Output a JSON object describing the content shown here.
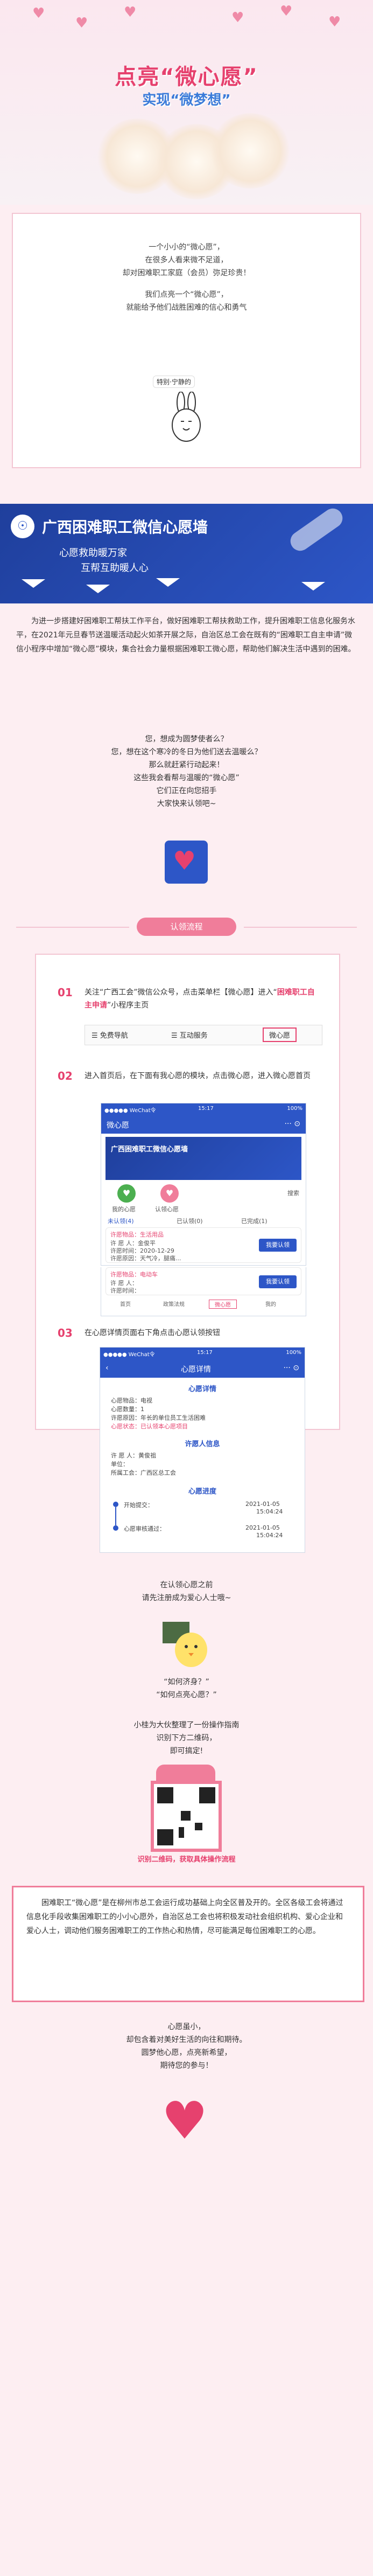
{
  "header": {
    "title": "点亮“微心愿”",
    "subtitle": "实现“微梦想”"
  },
  "intro_poem": [
    "一个小小的“微心愿”，",
    "在很多人看来微不足道，",
    "却对困难职工家庭（会员）弥足珍贵！",
    "我们点亮一个“微心愿”，",
    "就能给予他们战胜困难的信心和勇气"
  ],
  "bunny_caption": "特别·宁静的",
  "banner": {
    "title": "广西困难职工微信心愿墙",
    "slogan_line1": "心愿救助暖万家",
    "slogan_line2": "互帮互助暖人心"
  },
  "intro_paragraph": "为进一步搭建好困难职工帮扶工作平台，做好困难职工帮扶救助工作，提升困难职工信息化服务水平，在2021年元旦春节送温暖活动起火如茶开展之际，自治区总工会在既有的“困难职工自主申请”微信小程序中增加“微心愿”模块，集合社会力量根据困难职工微心愿，帮助他们解决生活中遇到的困难。",
  "questions": [
    "您，想成为圆梦使者么？",
    "您，想在这个寒冷的冬日为他们送去温暖么？",
    "那么就赶紧行动起来！",
    "这些我会看帮与温暖的“微心愿”",
    "它们正在向您招手",
    "大家快来认领吧~"
  ],
  "section_tag": "认领流程",
  "steps": [
    {
      "num": "01",
      "text_part1": "关注“广西工会”微信公众号，点击菜单栏【微心愿】进入“",
      "text_highlight": "困难职工自主申请",
      "text_part2": "”小程序主页"
    },
    {
      "num": "02",
      "text": "进入首页后，在下面有我心愿的模块，点击微心愿，进入微心愿首页"
    },
    {
      "num": "03",
      "text": "在心愿详情页面右下角点击心愿认领按钮"
    }
  ],
  "step1_menu": {
    "item1": "☰ 免费导航",
    "item2": "☰ 互动服务",
    "item3": "微心愿"
  },
  "phone1": {
    "status_left": "●●●●● WeChat令",
    "time": "15:17",
    "battery": "100%",
    "title": "微心愿",
    "banner_title": "广西困难职工微信心愿墙",
    "icon1": "我的心愿",
    "icon2": "认领心愿",
    "search": "搜索",
    "tabs": [
      "未认领(4)",
      "已认领(0)",
      "已完成(1)"
    ],
    "card1_title": "许愿物品：生活用品",
    "card1_person": "许 愿 人：金俊平",
    "card1_time": "许愿时间：2020-12-29",
    "card1_reason": "许愿原因：天气冷，腿痛...",
    "card1_btn": "我要认领",
    "card2_title": "许愿物品：电动车",
    "card2_person": "许 愿 人：",
    "card2_time": "许愿时间：",
    "card2_reason": "许愿原因：",
    "card2_btn": "我要认领",
    "nav": [
      "首页",
      "政策法规",
      "微心愿",
      "我的"
    ]
  },
  "phone2": {
    "status_left": "●●●●● WeChat令",
    "time": "15:17",
    "battery": "100%",
    "title": "心愿详情",
    "detail_header": "心愿详情",
    "rows": [
      "心愿物品：电视",
      "心愿数量：1",
      "许愿原因：年长的单位员工生活困难",
      "心愿状态：已认领本心愿项目"
    ],
    "person_header": "许愿人信息",
    "person_rows": [
      "许 愿 人：黄俊祖",
      "单位：",
      "所属工会：广西区总工会"
    ],
    "progress_header": "心愿进度",
    "progress": [
      {
        "label": "开始提交：",
        "date": "2021-01-05",
        "time": "15:04:24"
      },
      {
        "label": "心愿审核通过：",
        "date": "2021-01-05",
        "time": "15:04:24"
      }
    ]
  },
  "before_claim": [
    "在认领心愿之前",
    "请先注册成为爱心人士哦~"
  ],
  "chick_lines": [
    "“如何济身？”",
    "“如何点亮心愿？”"
  ],
  "guide_lines": [
    "小桂为大伙整理了一份操作指南",
    "识别下方二维码，",
    "即可搞定!"
  ],
  "qr_caption": "识别二维码，获取具体操作流程",
  "outro_paragraph": "困难职工“微心愿”是在柳州市总工会运行成功基础上向全区普及开的。全区各级工会将通过信息化手段收集困难职工的小小心愿外，自治区总工会也将积极发动社会组织机构、爱心企业和爱心人士，调动他们服务困难职工的工作热心和热情，尽可能满足每位困难职工的心愿。",
  "ending": [
    "心愿虽小，",
    "却包含着对美好生活的向往和期待。",
    "圆梦他心愿，点亮新希望，",
    "期待您的参与！"
  ]
}
